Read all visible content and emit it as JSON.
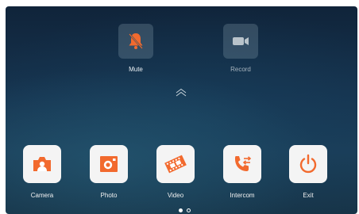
{
  "quick_actions": [
    {
      "label": "Mute",
      "icon": "bell-muted-icon"
    },
    {
      "label": "Record",
      "icon": "video-camera-icon"
    }
  ],
  "apps": [
    {
      "label": "Camera",
      "icon": "camera-icon"
    },
    {
      "label": "Photo",
      "icon": "photo-icon"
    },
    {
      "label": "Video",
      "icon": "film-icon"
    },
    {
      "label": "Intercom",
      "icon": "phone-intercom-icon"
    },
    {
      "label": "Exit",
      "icon": "power-icon"
    }
  ],
  "pager": {
    "current_page": 1,
    "total_pages": 2
  },
  "colors": {
    "accent": "#f26a2e",
    "tile": "#f4f4f4",
    "background": "#163450"
  }
}
